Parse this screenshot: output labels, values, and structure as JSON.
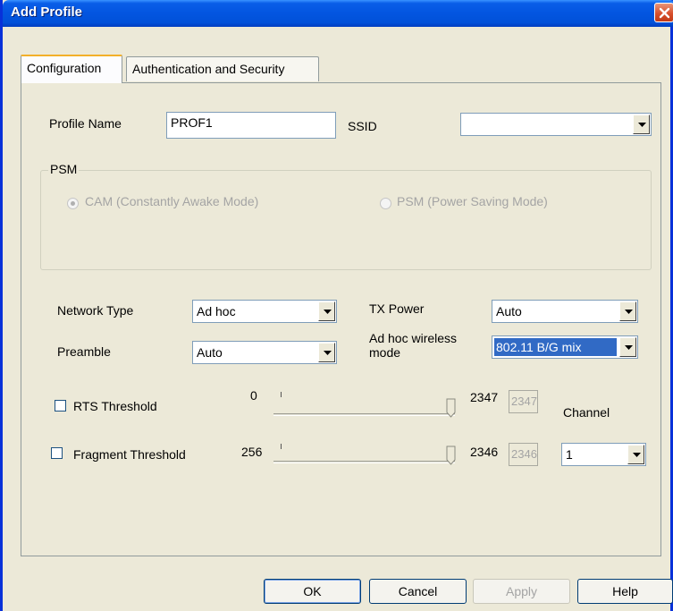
{
  "window": {
    "title": "Add Profile"
  },
  "tabs": [
    {
      "label": "Configuration",
      "active": true
    },
    {
      "label": "Authentication and Security",
      "active": false
    }
  ],
  "profile": {
    "name_label": "Profile Name",
    "name_value": "PROF1",
    "ssid_label": "SSID",
    "ssid_value": ""
  },
  "psm": {
    "group_label": "PSM",
    "cam_label": "CAM (Constantly Awake Mode)",
    "cam_selected": true,
    "psm_label": "PSM (Power Saving Mode)",
    "psm_selected": false
  },
  "network": {
    "network_type_label": "Network Type",
    "network_type_value": "Ad hoc",
    "tx_power_label": "TX Power",
    "tx_power_value": "Auto",
    "preamble_label": "Preamble",
    "preamble_value": "Auto",
    "adhoc_mode_label_line1": "Ad hoc wireless",
    "adhoc_mode_label_line2": "mode",
    "adhoc_mode_value": "802.11 B/G mix"
  },
  "rts": {
    "label": "RTS Threshold",
    "checked": false,
    "min": "0",
    "max": "2347",
    "value": "2347"
  },
  "fragment": {
    "label": "Fragment Threshold",
    "checked": false,
    "min": "256",
    "max": "2346",
    "value": "2346"
  },
  "channel": {
    "label": "Channel",
    "value": "1"
  },
  "buttons": {
    "ok": "OK",
    "cancel": "Cancel",
    "apply": "Apply",
    "help": "Help"
  },
  "colors": {
    "titlebar": "#0355e0",
    "dialog_bg": "#ece9d8",
    "selection": "#316ac5",
    "active_tab_accent": "#f2b02a"
  }
}
